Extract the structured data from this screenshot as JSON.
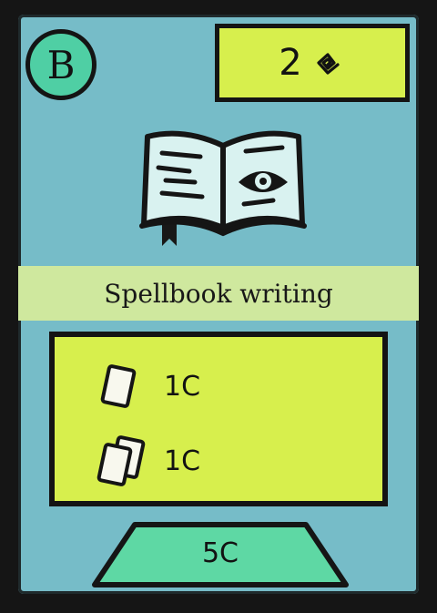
{
  "card": {
    "tier": "B",
    "points": "2",
    "points_icon": "spiral-rune-icon",
    "title": "Spellbook writing",
    "art_icon": "open-spellbook-icon",
    "costs": [
      {
        "icon": "single-card-icon",
        "value": "1C"
      },
      {
        "icon": "double-card-icon",
        "value": "1C"
      }
    ],
    "price": "5C"
  },
  "colors": {
    "background": "#76bcc8",
    "border": "#151515",
    "tier_badge": "#4fcfa4",
    "points_box": "#d7ef4d",
    "title_band": "#cfe89e",
    "cost_box": "#d7ef4d",
    "price_tab": "#5ed8a4"
  }
}
